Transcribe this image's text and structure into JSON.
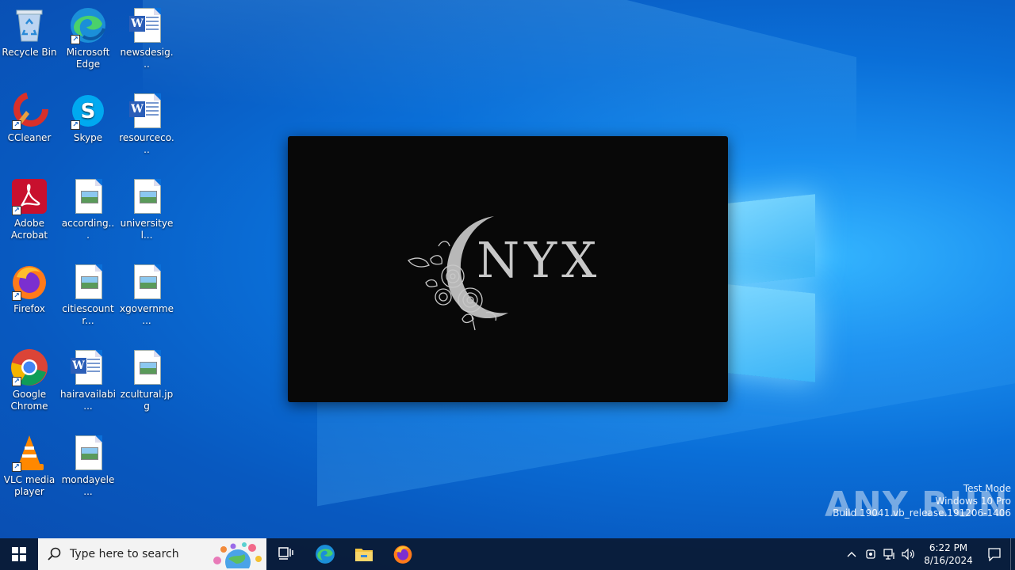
{
  "desktop": {
    "icons": [
      {
        "label": "Recycle Bin"
      },
      {
        "label": "Microsoft Edge"
      },
      {
        "label": "newsdesig..."
      },
      {
        "label": "CCleaner"
      },
      {
        "label": "Skype"
      },
      {
        "label": "resourceco..."
      },
      {
        "label": "Adobe Acrobat"
      },
      {
        "label": "according..."
      },
      {
        "label": "universityel..."
      },
      {
        "label": "Firefox"
      },
      {
        "label": "citiescountr..."
      },
      {
        "label": "xgovernme..."
      },
      {
        "label": "Google Chrome"
      },
      {
        "label": "hairavailabi..."
      },
      {
        "label": "zcultural.jpg"
      },
      {
        "label": "VLC media player"
      },
      {
        "label": "mondayele..."
      }
    ]
  },
  "splash": {
    "logo_text": "NYX"
  },
  "watermark": {
    "brand": "ANY RUN",
    "mode": "Test Mode",
    "edition": "Windows 10 Pro",
    "build": "Build 19041.vb_release.191206-1406"
  },
  "taskbar": {
    "search_placeholder": "Type here to search",
    "time": "6:22 PM",
    "date": "8/16/2024",
    "pinned": [
      "task-view-icon",
      "edge-icon",
      "file-explorer-icon",
      "firefox-icon"
    ]
  },
  "colors": {
    "desktop_bg": "#0a6fd8",
    "taskbar_bg": "#0a1932",
    "splash_bg": "#080808",
    "logo_text": "#c8c8c8"
  }
}
